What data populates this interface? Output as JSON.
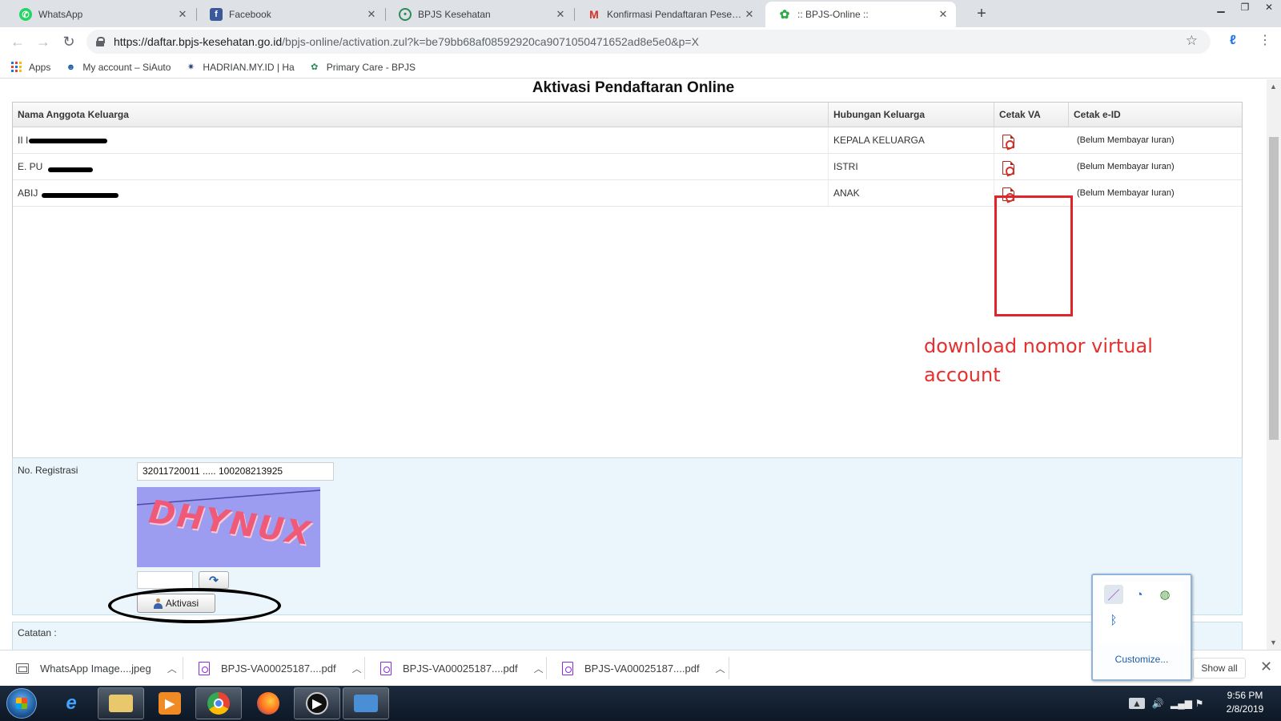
{
  "browser": {
    "tabs": [
      {
        "title": "WhatsApp",
        "icon": "whatsapp-icon",
        "color": "#25d366"
      },
      {
        "title": "Facebook",
        "icon": "facebook-icon",
        "color": "#3b5998"
      },
      {
        "title": "BPJS Kesehatan",
        "icon": "bpjs-icon",
        "color": "#2e8b57"
      },
      {
        "title": "Konfirmasi Pendaftaran Peserta B",
        "icon": "gmail-icon",
        "color": "#d93025"
      },
      {
        "title": ":: BPJS-Online ::",
        "icon": "bpjs-icon",
        "color": "#2eaa4a",
        "active": true
      }
    ],
    "url_host": "https://daftar.bpjs-kesehatan.go.id",
    "url_path": "/bpjs-online/activation.zul?k=be79bb68af08592920ca9071050471652ad8e5e0&p=X",
    "bookmarks": [
      {
        "label": "Apps",
        "icon": "apps-grid-icon"
      },
      {
        "label": "My account – SiAuto",
        "icon": "account-icon"
      },
      {
        "label": "HADRIAN.MY.ID | Ha",
        "icon": "gear-icon"
      },
      {
        "label": "Primary Care - BPJS",
        "icon": "bpjs-icon"
      }
    ]
  },
  "page": {
    "title": "Aktivasi Pendaftaran Online",
    "columns": [
      "Nama Anggota Keluarga",
      "Hubungan Keluarga",
      "Cetak VA",
      "Cetak e-ID"
    ],
    "rows": [
      {
        "name": "II I",
        "relation": "KEPALA KELUARGA",
        "eid": "(Belum Membayar Iuran)"
      },
      {
        "name": "E. PU",
        "relation": "ISTRI",
        "eid": "(Belum Membayar Iuran)"
      },
      {
        "name": "ABIJ",
        "relation": "ANAK",
        "eid": "(Belum Membayar Iuran)"
      }
    ],
    "annotation": "download nomor virtual account",
    "annotation_color": "#e53030",
    "form": {
      "reg_label": "No. Registrasi",
      "reg_value": "32011720011 ..... 100208213925",
      "captcha_text": "DHYNUX",
      "aktivasi_label": "Aktivasi",
      "catatan_label": "Catatan :"
    }
  },
  "downloads": [
    {
      "name": "WhatsApp Image....jpeg",
      "type": "image"
    },
    {
      "name": "BPJS-VA00025187....pdf",
      "type": "pdf"
    },
    {
      "name": "BPJS-VA00025187....pdf",
      "type": "pdf"
    },
    {
      "name": "BPJS-VA00025187....pdf",
      "type": "pdf"
    }
  ],
  "shelf": {
    "show_all": "Show all"
  },
  "tray_popup": {
    "customize": "Customize..."
  },
  "taskbar": {
    "time": "9:56 PM",
    "date": "2/8/2019"
  }
}
